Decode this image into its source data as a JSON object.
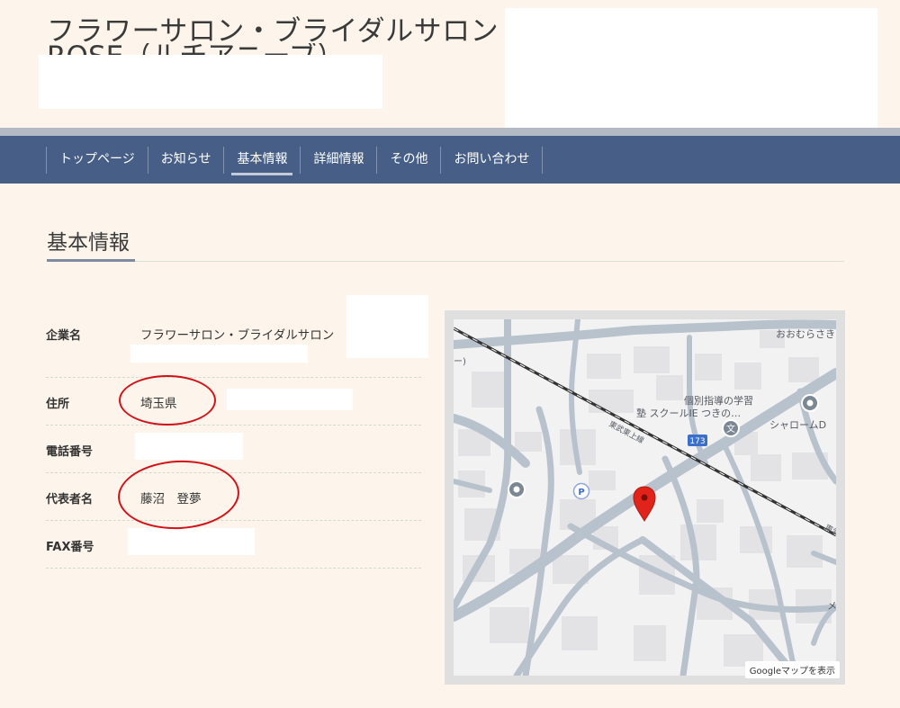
{
  "header": {
    "title": "フラワーサロン・ブライダルサロン",
    "title_line2": "ROSE（ルチアニーブ）"
  },
  "nav": {
    "items": [
      {
        "label": "トップページ"
      },
      {
        "label": "お知らせ"
      },
      {
        "label": "基本情報"
      },
      {
        "label": "詳細情報"
      },
      {
        "label": "その他"
      },
      {
        "label": "お問い合わせ"
      }
    ],
    "active_index": 2
  },
  "main": {
    "heading": "基本情報",
    "info": {
      "company": {
        "label": "企業名",
        "value": "フラワーサロン・ブライダルサロン"
      },
      "address": {
        "label": "住所",
        "value": "埼玉県"
      },
      "phone": {
        "label": "電話番号",
        "value": ""
      },
      "representative": {
        "label": "代表者名",
        "value": "藤沼　登夢"
      },
      "fax": {
        "label": "FAX番号",
        "value": ""
      }
    }
  },
  "map": {
    "labels": {
      "area_name": "おおむらさき",
      "railway": "東武東上線",
      "railway_edge": "東武",
      "school_line1": "個別指導の学習",
      "school_line2": "塾 スクールIE つきの…",
      "place": "シャロームD",
      "route_number": "173",
      "parking": "P",
      "school_symbol": "文",
      "edge_paren": "ー)",
      "edge_mark": "メ"
    },
    "link_label": "Googleマップを表示",
    "colors": {
      "background": "#f2f2f2",
      "road": "#b8c2cd",
      "building": "#e3e3e6",
      "railway": "#333333",
      "pin": "#e1241b",
      "poi": "#7b8894"
    },
    "icons": [
      "map-pin-icon",
      "parking-icon",
      "school-icon",
      "place-pin-icon"
    ]
  },
  "annotations": {
    "circle_color": "#d21218",
    "circled_fields": [
      "address",
      "representative"
    ]
  }
}
